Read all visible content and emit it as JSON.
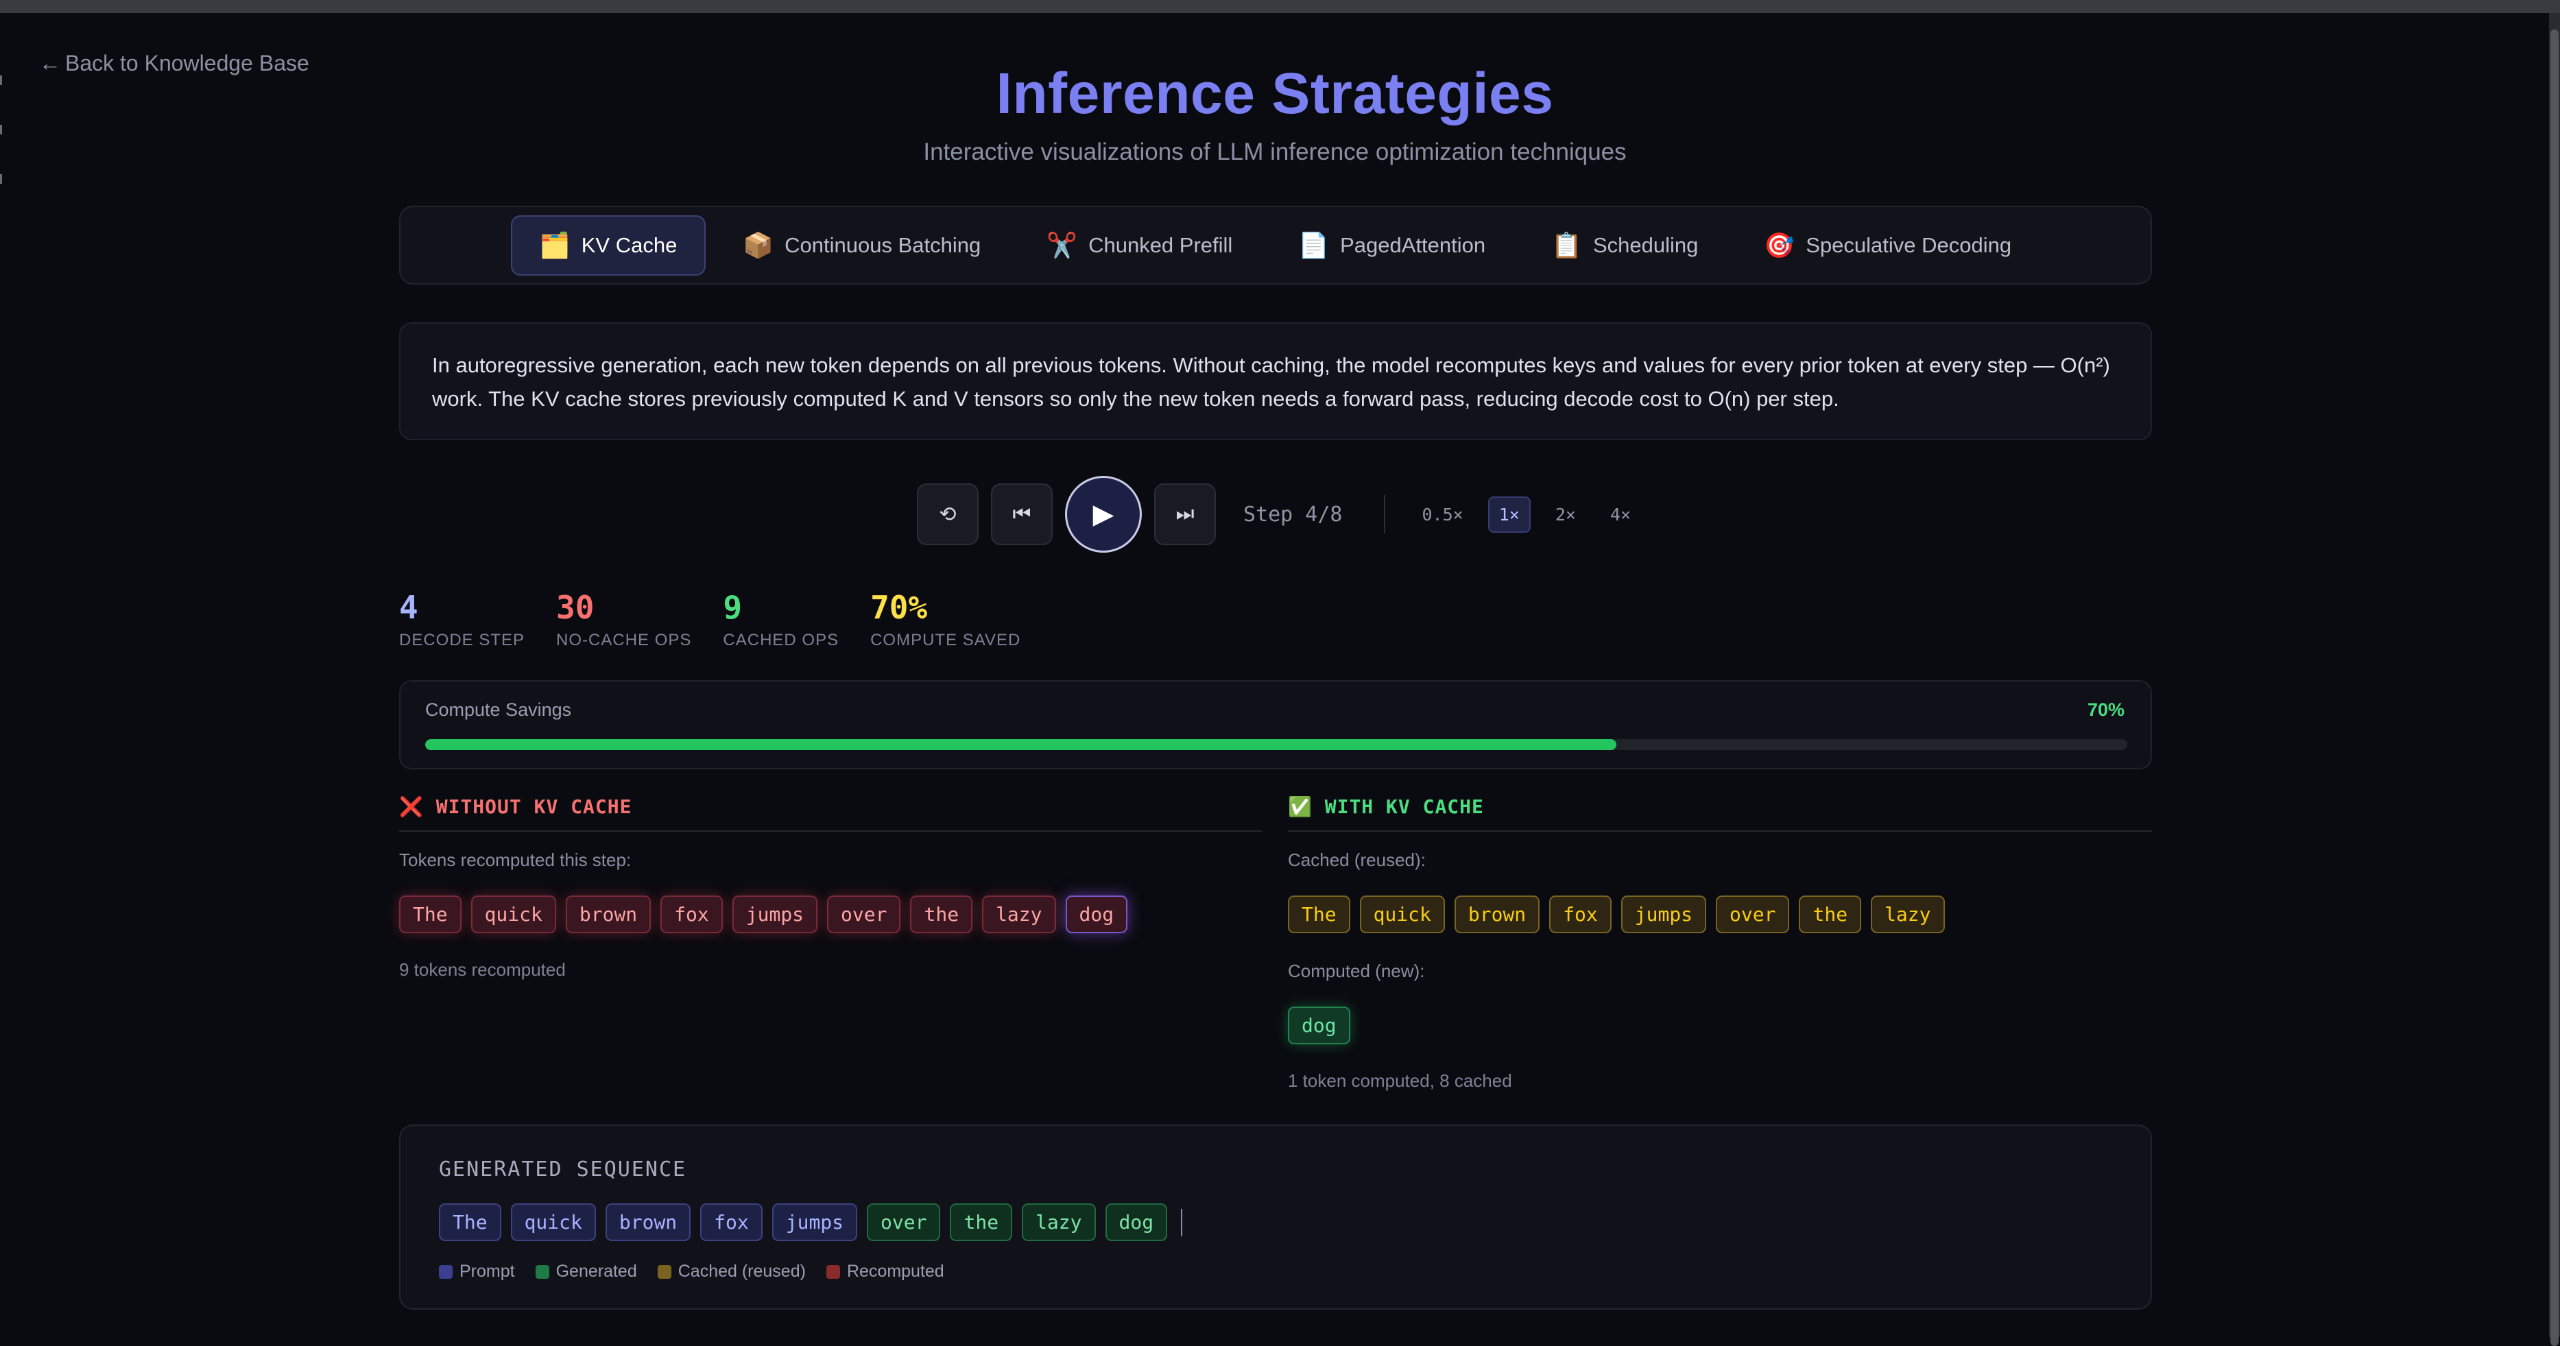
{
  "nav": {
    "back_label": "Back to Knowledge Base",
    "back_arrow": "←"
  },
  "header": {
    "title": "Inference Strategies",
    "subtitle": "Interactive visualizations of LLM inference optimization techniques"
  },
  "tabs": [
    {
      "icon": "🗂️",
      "label": "KV Cache",
      "active": true
    },
    {
      "icon": "📦",
      "label": "Continuous Batching",
      "active": false
    },
    {
      "icon": "✂️",
      "label": "Chunked Prefill",
      "active": false
    },
    {
      "icon": "📄",
      "label": "PagedAttention",
      "active": false
    },
    {
      "icon": "📋",
      "label": "Scheduling",
      "active": false
    },
    {
      "icon": "🎯",
      "label": "Speculative Decoding",
      "active": false
    }
  ],
  "description": "In autoregressive generation, each new token depends on all previous tokens. Without caching, the model recomputes keys and values for every prior token at every step — O(n²) work. The KV cache stores previously computed K and V tensors so only the new token needs a forward pass, reducing decode cost to O(n) per step.",
  "controls": {
    "reset_icon": "⟲",
    "prev_icon": "⏮",
    "play_icon": "▶",
    "next_icon": "⏭",
    "step_label": "Step 4/8",
    "speeds": [
      "0.5×",
      "1×",
      "2×",
      "4×"
    ],
    "active_speed": "1×"
  },
  "stats": [
    {
      "value": "4",
      "label": "DECODE STEP",
      "color": "#a5b4fc"
    },
    {
      "value": "30",
      "label": "NO-CACHE OPS",
      "color": "#f87171"
    },
    {
      "value": "9",
      "label": "CACHED OPS",
      "color": "#4ade80"
    },
    {
      "value": "70%",
      "label": "COMPUTE SAVED",
      "color": "#fde047"
    }
  ],
  "savings": {
    "label": "Compute Savings",
    "percent_label": "70%",
    "fraction": 0.7
  },
  "without_cache": {
    "icon": "❌",
    "heading": "WITHOUT KV CACHE",
    "sub_label": "Tokens recomputed this step:",
    "tokens": [
      "The",
      "quick",
      "brown",
      "fox",
      "jumps",
      "over",
      "the",
      "lazy",
      "dog"
    ],
    "note": "9 tokens recomputed"
  },
  "with_cache": {
    "icon": "✅",
    "heading": "WITH KV CACHE",
    "cached_label": "Cached (reused):",
    "cached_tokens": [
      "The",
      "quick",
      "brown",
      "fox",
      "jumps",
      "over",
      "the",
      "lazy"
    ],
    "computed_label": "Computed (new):",
    "computed_tokens": [
      "dog"
    ],
    "note": "1 token computed, 8 cached"
  },
  "generated": {
    "heading": "GENERATED SEQUENCE",
    "prompt_tokens": [
      "The",
      "quick",
      "brown",
      "fox",
      "jumps"
    ],
    "generated_tokens": [
      "over",
      "the",
      "lazy",
      "dog"
    ],
    "legend": [
      {
        "label": "Prompt",
        "color": "#3b3f8f"
      },
      {
        "label": "Generated",
        "color": "#1f7a45"
      },
      {
        "label": "Cached (reused)",
        "color": "#7a6320"
      },
      {
        "label": "Recomputed",
        "color": "#8a2a2a"
      }
    ]
  }
}
